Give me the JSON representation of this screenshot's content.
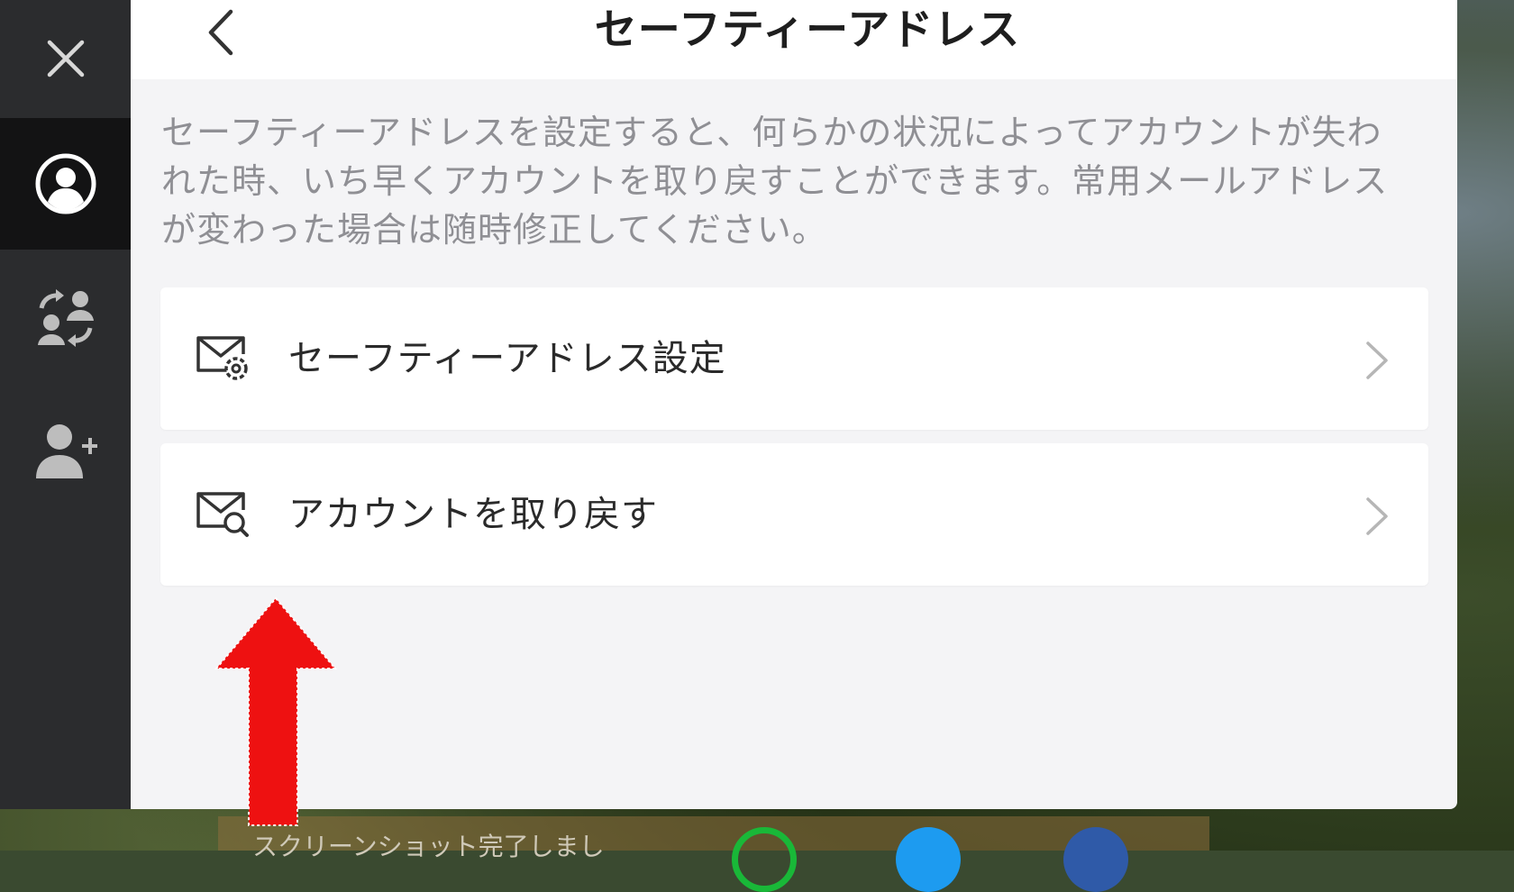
{
  "header": {
    "title": "セーフティーアドレス"
  },
  "description": "セーフティーアドレスを設定すると、何らかの状況によってアカウントが失われた時、いち早くアカウントを取り戻すことができます。常用メールアドレスが変わった場合は随時修正してください。",
  "menu": [
    {
      "label": "セーフティーアドレス設定",
      "icon": "mail-gear-icon"
    },
    {
      "label": "アカウントを取り戻す",
      "icon": "mail-search-icon"
    }
  ],
  "sidebar": {
    "items": [
      {
        "icon": "close-icon"
      },
      {
        "icon": "account-icon",
        "active": true
      },
      {
        "icon": "switch-account-icon"
      },
      {
        "icon": "add-user-icon"
      }
    ]
  },
  "bottom_bar": {
    "text": "スクリーンショット完了しまし"
  },
  "colors": {
    "sidebar": "#2b2c2e",
    "sidebar_active": "#131314",
    "panel": "#f4f4f6",
    "card": "#ffffff",
    "arrow": "#ee1111",
    "line_share": "#19b838",
    "twitter_share": "#1d9bf0",
    "facebook_share": "#1877f2"
  }
}
